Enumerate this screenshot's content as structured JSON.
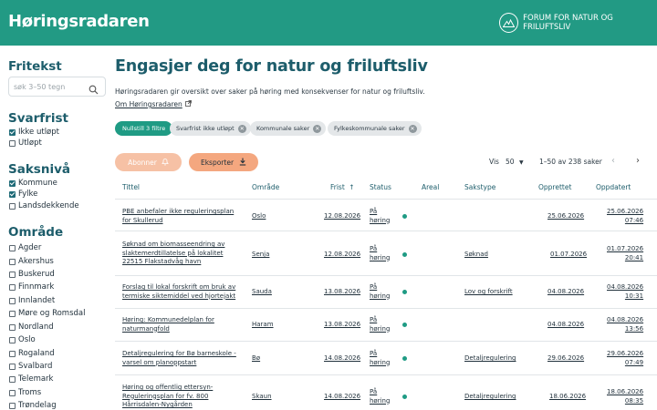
{
  "header": {
    "brand": "Høringsradaren",
    "forum_label": "FORUM FOR NATUR OG FRILUFTSLIV"
  },
  "sidebar": {
    "search": {
      "heading": "Fritekst",
      "placeholder": "søk 3–50 tegn"
    },
    "deadline": {
      "heading": "Svarfrist",
      "options": [
        {
          "label": "Ikke utløpt",
          "checked": true
        },
        {
          "label": "Utløpt",
          "checked": false
        }
      ]
    },
    "level": {
      "heading": "Saksnivå",
      "options": [
        {
          "label": "Kommune",
          "checked": true
        },
        {
          "label": "Fylke",
          "checked": true
        },
        {
          "label": "Landsdekkende",
          "checked": false
        }
      ]
    },
    "area": {
      "heading": "Område",
      "options": [
        "Agder",
        "Akershus",
        "Buskerud",
        "Finnmark",
        "Innlandet",
        "Møre og Romsdal",
        "Nordland",
        "Oslo",
        "Rogaland",
        "Svalbard",
        "Telemark",
        "Troms",
        "Trøndelag"
      ]
    }
  },
  "main": {
    "title": "Engasjer deg for natur og friluftsliv",
    "intro": "Høringsradaren gir oversikt over saker på høring med konsekvenser for natur og friluftsliv.",
    "about_link": "Om Høringsradaren",
    "reset_filters": "Nullstill 3 filtre",
    "active_filters": [
      "Svarfrist ikke utløpt",
      "Kommunale saker",
      "Fylkeskommunale saker"
    ],
    "subscribe_label": "Abonner",
    "export_label": "Eksporter",
    "show_label": "Vis",
    "per_page": "50",
    "range_text": "1–50 av 238 saker"
  },
  "table": {
    "columns": {
      "title": "Tittel",
      "area": "Område",
      "deadline": "Frist",
      "status": "Status",
      "region": "Areal",
      "casetype": "Sakstype",
      "created": "Opprettet",
      "updated": "Oppdatert"
    },
    "rows": [
      {
        "title": [
          "PBE anbefaler ikke reguleringsplan",
          "for Skullerud"
        ],
        "area": "Oslo",
        "deadline": "12.08.2026",
        "status": [
          "På",
          "høring"
        ],
        "casetype": "",
        "created": "25.06.2026",
        "updated": [
          "25.06.2026",
          "07:46"
        ]
      },
      {
        "title": [
          "Søknad om biomasseendring av",
          "slaktemerdtillatelse på lokalitet",
          "22515 Flakstadvåg havn"
        ],
        "area": "Senja",
        "deadline": "12.08.2026",
        "status": [
          "På",
          "høring"
        ],
        "casetype": "Søknad",
        "created": "01.07.2026",
        "updated": [
          "01.07.2026",
          "20:41"
        ]
      },
      {
        "title": [
          "Forslag til lokal forskrift om bruk av",
          "termiske siktemiddel ved hjortejakt"
        ],
        "area": "Sauda",
        "deadline": "13.08.2026",
        "status": [
          "På",
          "høring"
        ],
        "casetype": "Lov og forskrift",
        "created": "04.08.2026",
        "updated": [
          "04.08.2026",
          "10:31"
        ]
      },
      {
        "title": [
          "Høring: Kommunedelplan for",
          "naturmangfold"
        ],
        "area": "Haram",
        "deadline": "13.08.2026",
        "status": [
          "På",
          "høring"
        ],
        "casetype": "",
        "created": "04.08.2026",
        "updated": [
          "04.08.2026",
          "13:56"
        ]
      },
      {
        "title": [
          "Detaljregulering for Bø barneskole -",
          "varsel om planoppstart"
        ],
        "area": "Bø",
        "deadline": "14.08.2026",
        "status": [
          "På",
          "høring"
        ],
        "casetype": "Detaljregulering",
        "created": "29.06.2026",
        "updated": [
          "29.06.2026",
          "07:49"
        ]
      },
      {
        "title": [
          "Høring og offentlig ettersyn-",
          "Reguleringsplan for fv. 800",
          "Hårrisdalen-Nygården"
        ],
        "area": "Skaun",
        "deadline": "14.08.2026",
        "status": [
          "På",
          "høring"
        ],
        "casetype": "Detaljregulering",
        "created": "18.06.2026",
        "updated": [
          "18.06.2026",
          "08:35"
        ]
      }
    ]
  }
}
